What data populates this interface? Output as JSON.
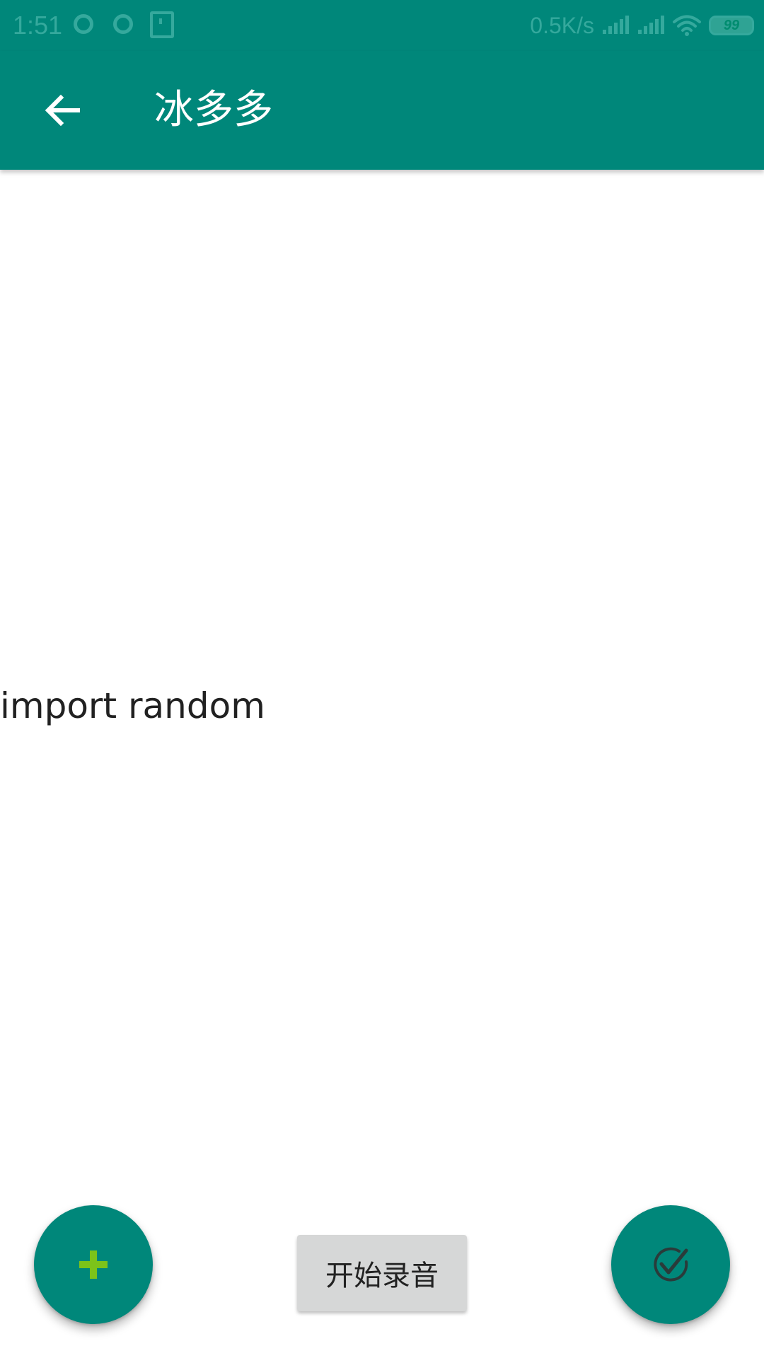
{
  "status_bar": {
    "time": "1:51",
    "net_speed": "0.5K/s",
    "battery_level": "99"
  },
  "app_bar": {
    "title": "冰多多",
    "back_icon": "arrow-left-icon"
  },
  "content": {
    "text": "import random"
  },
  "actions": {
    "add_icon": "plus-icon",
    "record_label": "开始录音",
    "confirm_icon": "check-circle-icon"
  },
  "colors": {
    "primary": "#00877A",
    "add_icon": "#7CC31A",
    "record_button_bg": "#D6D7D7"
  }
}
